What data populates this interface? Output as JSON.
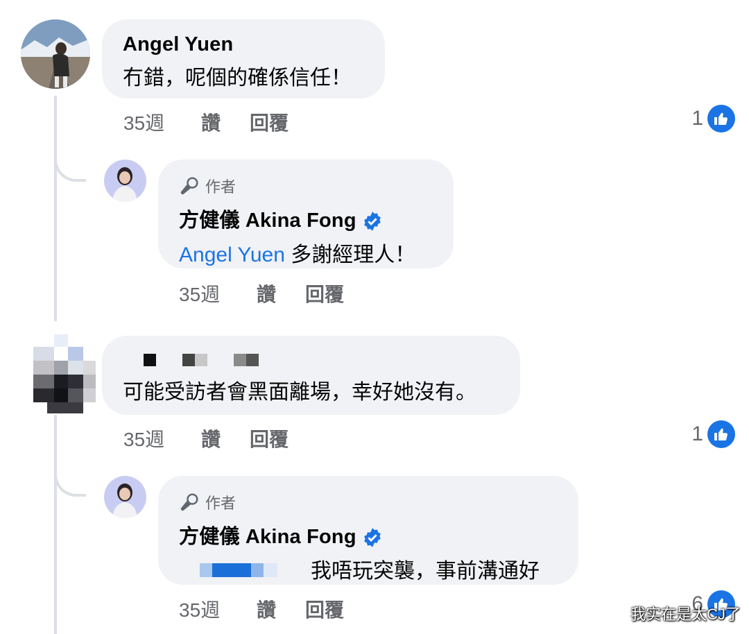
{
  "comments": [
    {
      "author": "Angel Yuen",
      "text": "冇錯，呢個的確係信任！",
      "time": "35週",
      "like_label": "讚",
      "reply_label": "回覆",
      "like_count": "1"
    },
    {
      "author_badge": "作者",
      "author": "方健儀 Akina Fong",
      "mention": "Angel Yuen",
      "text": "多謝經理人！",
      "time": "35週",
      "like_label": "讚",
      "reply_label": "回覆"
    },
    {
      "author": "",
      "text": "可能受訪者會黑面離場，幸好她沒有。",
      "time": "35週",
      "like_label": "讚",
      "reply_label": "回覆",
      "like_count": "1"
    },
    {
      "author_badge": "作者",
      "author": "方健儀 Akina Fong",
      "text": "我唔玩突襲，事前溝通好",
      "time": "35週",
      "like_label": "讚",
      "reply_label": "回覆",
      "like_count": "6"
    }
  ],
  "watermark": "我实在是太CJ了",
  "colors": {
    "accent": "#1b74e4",
    "bubble": "#f0f2f5",
    "meta": "#65676b"
  },
  "icons": [
    "thumbs-up-icon",
    "microphone-icon",
    "verified-badge-icon"
  ]
}
